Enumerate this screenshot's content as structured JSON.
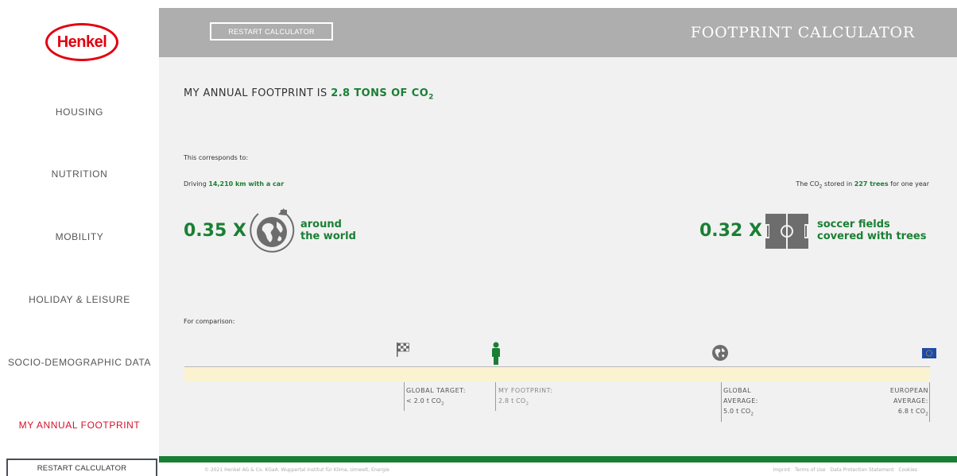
{
  "logo": {
    "text": "Henkel"
  },
  "sidebar": {
    "items": [
      {
        "label": "HOUSING"
      },
      {
        "label": "NUTRITION"
      },
      {
        "label": "MOBILITY"
      },
      {
        "label": "HOLIDAY & LEISURE"
      },
      {
        "label": "SOCIO-DEMOGRAPHIC DATA"
      },
      {
        "label": "MY ANNUAL FOOTPRINT"
      }
    ],
    "active_index": 5,
    "restart_label": "RESTART CALCULATOR"
  },
  "header": {
    "restart_label": "RESTART CALCULATOR",
    "title": "FOOTPRINT CALCULATOR"
  },
  "result": {
    "prefix": "MY ANNUAL FOOTPRINT IS",
    "value": "2.8 TONS OF CO",
    "sub": "2"
  },
  "correspond": {
    "intro": "This corresponds to:",
    "driving_prefix": "Driving",
    "driving_value": "14,210 km with a car",
    "trees_prefix": "The CO",
    "trees_sub": "2",
    "trees_mid": "stored in",
    "trees_value": "227 trees",
    "trees_suffix": "for one year",
    "world_factor": "0.35 X",
    "world_label_1": "around",
    "world_label_2": "the world",
    "field_factor": "0.32 X",
    "field_label_1": "soccer fields",
    "field_label_2": "covered with trees"
  },
  "comparison": {
    "intro": "For comparison:",
    "markers": [
      {
        "line1": "GLOBAL TARGET:",
        "line2": "",
        "value": "< 2.0 t CO",
        "sub": "2",
        "icon": "checkered-flag-icon"
      },
      {
        "line1": "MY FOOTPRINT:",
        "line2": "",
        "value": "2.8 t CO",
        "sub": "2",
        "icon": "person-icon"
      },
      {
        "line1": "GLOBAL",
        "line2": "AVERAGE:",
        "value": "5.0 t CO",
        "sub": "2",
        "icon": "globe-icon"
      },
      {
        "line1": "EUROPEAN",
        "line2": "AVERAGE:",
        "value": "6.8 t CO",
        "sub": "2",
        "icon": "eu-flag-icon"
      }
    ]
  },
  "footer": {
    "copyright": "© 2021 Henkel AG & Co. KGaA. Wuppertal Institut für Klima, Umwelt, Energie",
    "links": [
      "Imprint",
      "Terms of Use",
      "Data Protection Statement",
      "Cookies"
    ]
  },
  "colors": {
    "accent_green": "#1a7f34",
    "active_red": "#d5102b",
    "header_gray": "#aeaeae"
  }
}
